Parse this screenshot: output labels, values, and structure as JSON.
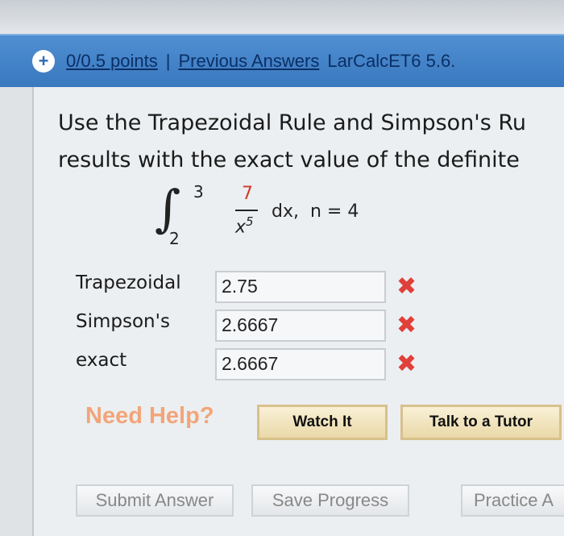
{
  "header": {
    "points": "0/0.5 points",
    "separator": "|",
    "previous_answers": "Previous Answers",
    "course": "LarCalcET6 5.6."
  },
  "question": {
    "line1": "Use the Trapezoidal Rule and Simpson's Ru",
    "line2": "results with the exact value of the definite"
  },
  "integral": {
    "upper": "3",
    "lower": "2",
    "numerator": "7",
    "denominator_base": "x",
    "denominator_exp": "5",
    "dx": "dx,",
    "n": "n = 4"
  },
  "answers": [
    {
      "label": "Trapezoidal",
      "value": "2.75"
    },
    {
      "label": "Simpson's",
      "value": "2.6667"
    },
    {
      "label": "exact",
      "value": "2.6667"
    }
  ],
  "help": {
    "label": "Need Help?",
    "watch": "Watch It",
    "tutor": "Talk to a Tutor"
  },
  "buttons": {
    "submit": "Submit Answer",
    "save": "Save Progress",
    "practice": "Practice A"
  },
  "colors": {
    "header_bg": "#3f7ec4",
    "link": "#0b2f66",
    "error": "#e0403a",
    "need_help": "#f2a57a"
  }
}
